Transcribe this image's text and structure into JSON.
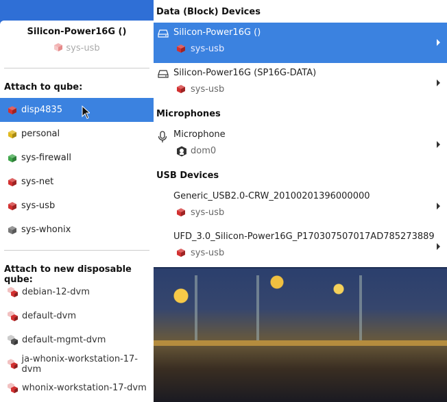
{
  "left_menu": {
    "device_title": "Silicon-Power16G ()",
    "device_backend": "sys-usb",
    "attach_header": "Attach to qube:",
    "qubes": [
      {
        "label": "disp4835",
        "color": "#d23030",
        "selected": true
      },
      {
        "label": "personal",
        "color": "#e0b81c",
        "selected": false
      },
      {
        "label": "sys-firewall",
        "color": "#3ea64a",
        "selected": false
      },
      {
        "label": "sys-net",
        "color": "#d23030",
        "selected": false
      },
      {
        "label": "sys-usb",
        "color": "#d23030",
        "selected": false
      },
      {
        "label": "sys-whonix",
        "color": "#777777",
        "selected": false
      }
    ],
    "disposable_header": "Attach to new disposable qube:",
    "dvms": [
      {
        "label": "debian-12-dvm",
        "color": "#d23030"
      },
      {
        "label": "default-dvm",
        "color": "#d23030"
      },
      {
        "label": "default-mgmt-dvm",
        "color": "#555555"
      },
      {
        "label": "ja-whonix-workstation-17-dvm",
        "color": "#d23030"
      },
      {
        "label": "whonix-workstation-17-dvm",
        "color": "#d23030"
      }
    ]
  },
  "right_panel": {
    "block_header": "Data (Block) Devices",
    "block_devices": [
      {
        "name": "Silicon-Power16G ()",
        "qube": "sys-usb",
        "selected": true
      },
      {
        "name": "Silicon-Power16G (SP16G-DATA)",
        "qube": "sys-usb",
        "selected": false
      }
    ],
    "mic_header": "Microphones",
    "mic_devices": [
      {
        "name": "Microphone",
        "qube": "dom0"
      }
    ],
    "usb_header": "USB Devices",
    "usb_devices": [
      {
        "name": "Generic_USB2.0-CRW_20100201396000000",
        "qube": "sys-usb"
      },
      {
        "name": "UFD_3.0_Silicon-Power16G_P170307507017AD785273889",
        "qube": "sys-usb"
      }
    ]
  },
  "colors": {
    "selection": "#3b82e0",
    "qube_red": "#d23030"
  }
}
